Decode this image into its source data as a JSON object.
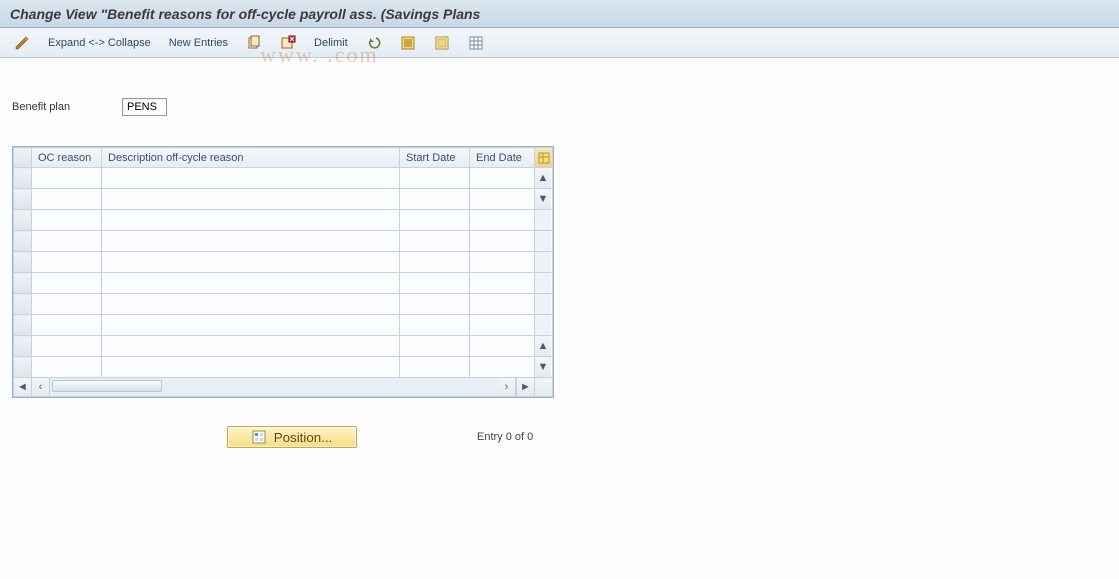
{
  "title": "Change View \"Benefit reasons for off-cycle payroll ass. (Savings Plans",
  "toolbar": {
    "expand_collapse": "Expand <-> Collapse",
    "new_entries": "New Entries",
    "delimit": "Delimit"
  },
  "form": {
    "benefit_plan_label": "Benefit plan",
    "benefit_plan_value": "PENS"
  },
  "table": {
    "headers": {
      "oc_reason": "OC reason",
      "description": "Description off-cycle reason",
      "start_date": "Start Date",
      "end_date": "End Date"
    },
    "row_count_empty": 10
  },
  "footer": {
    "position_label": "Position...",
    "entry_text": "Entry 0 of 0"
  },
  "watermark": "www.            .com"
}
